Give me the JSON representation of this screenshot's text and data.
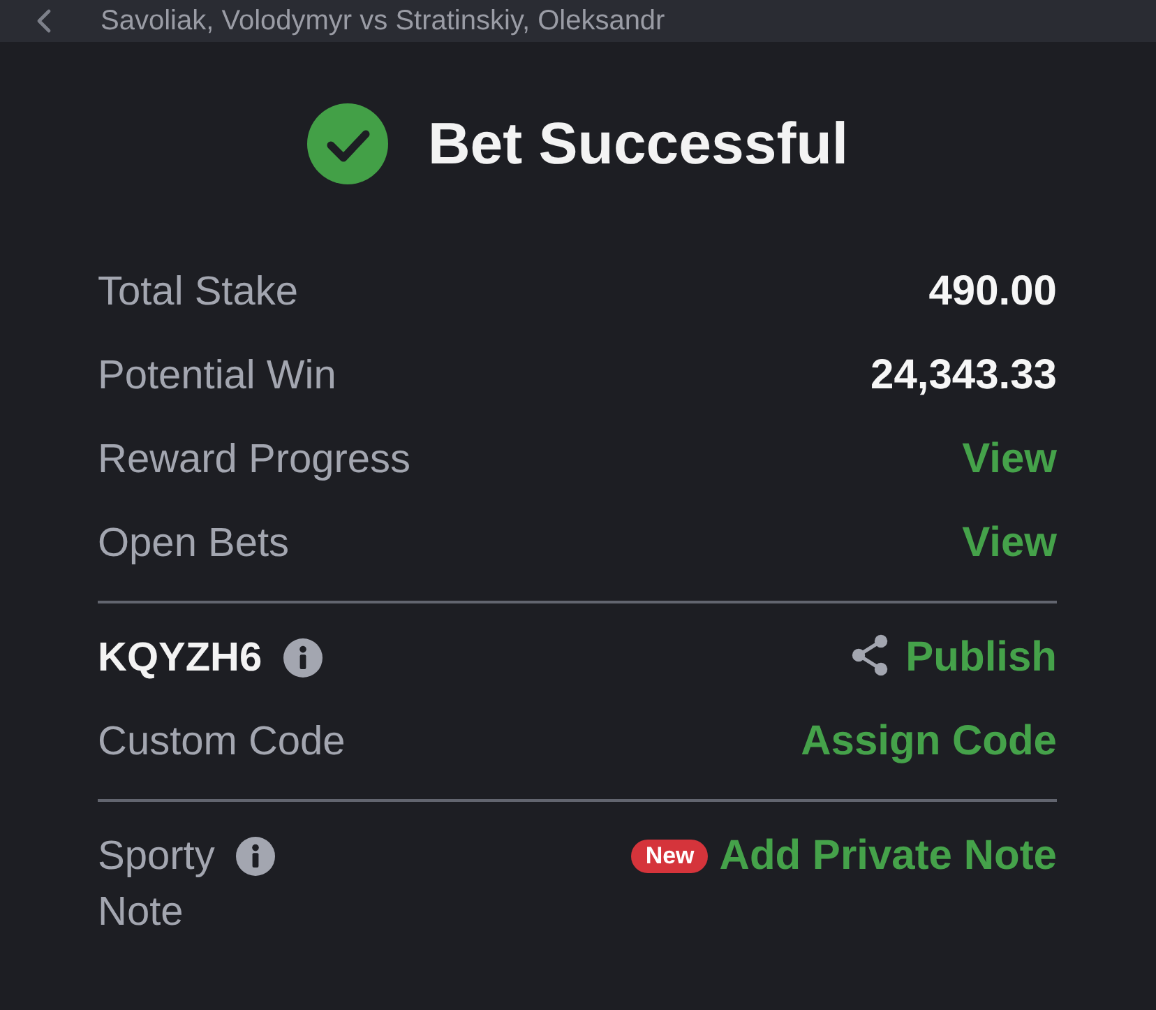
{
  "header": {
    "match": "Savoliak, Volodymyr vs Stratinskiy, Oleksandr"
  },
  "title": "Bet Successful",
  "sections": [
    {
      "rows": [
        {
          "label": "Total Stake",
          "label_strong": false,
          "info": false,
          "kind": "amount",
          "value": "490.00"
        },
        {
          "label": "Potential Win",
          "label_strong": false,
          "info": false,
          "kind": "amount",
          "value": "24,343.33"
        },
        {
          "label": "Reward Progress",
          "label_strong": false,
          "info": false,
          "kind": "link",
          "value": "View"
        },
        {
          "label": "Open Bets",
          "label_strong": false,
          "info": false,
          "kind": "link",
          "value": "View"
        }
      ]
    },
    {
      "rows": [
        {
          "label": "KQYZH6",
          "label_strong": true,
          "info": true,
          "kind": "share_link",
          "value": "Publish"
        },
        {
          "label": "Custom Code",
          "label_strong": false,
          "info": false,
          "kind": "link",
          "value": "Assign Code"
        }
      ]
    },
    {
      "rows": [
        {
          "label": "Sporty Note",
          "label_strong": false,
          "info": true,
          "kind": "link",
          "badge": "New",
          "value": "Add Private Note"
        }
      ]
    }
  ]
}
